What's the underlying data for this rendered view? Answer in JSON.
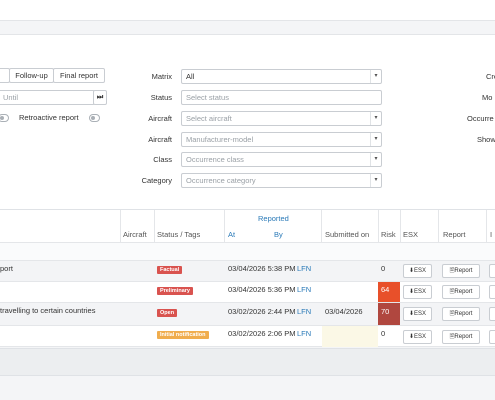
{
  "tabs": [
    "Follow-up",
    "Final report"
  ],
  "until_placeholder": "Until",
  "last_icon": "⏭",
  "retroactive_label": "Retroactive report",
  "filters": {
    "matrix_label": "Matrix",
    "matrix_value": "All",
    "status_label": "Status",
    "status_placeholder": "Select status",
    "aircraft_label": "Aircraft",
    "aircraft_placeholder": "Select aircraft",
    "aircraft2_label": "Aircraft",
    "aircraft2_placeholder": "Manufacturer-model",
    "class_label": "Class",
    "class_placeholder": "Occurrence class",
    "category_label": "Category",
    "category_placeholder": "Occurrence category"
  },
  "right_labels": [
    "Cre",
    "Mo",
    "Occurre",
    "Show"
  ],
  "table": {
    "headers": {
      "aircraft": "Aircraft",
      "status_tags": "Status / Tags",
      "reported": "Reported",
      "at": "At",
      "by": "By",
      "submitted_on": "Submitted on",
      "risk": "Risk",
      "esx": "ESX",
      "report": "Report",
      "last": "I"
    },
    "rows": [
      {
        "title": "port",
        "tag": "Factual",
        "tag_color": "#d9534f",
        "at": "03/04/2026 5:38 PM",
        "by": "LFN",
        "submitted": "",
        "risk": "0",
        "risk_color": "",
        "esx": "ESX",
        "report": "Report"
      },
      {
        "title": "",
        "tag": "Preliminary",
        "tag_color": "#d9534f",
        "at": "03/04/2026 5:36 PM",
        "by": "LFN",
        "submitted": "",
        "risk": "64",
        "risk_color": "#e8502a",
        "esx": "ESX",
        "report": "Report"
      },
      {
        "title": "travelling to certain countries",
        "tag": "Open",
        "tag_color": "#d9534f",
        "at": "03/02/2026 2:44 PM",
        "by": "LFN",
        "submitted": "03/04/2026",
        "risk": "70",
        "risk_color": "#b0473f",
        "esx": "ESX",
        "report": "Report"
      },
      {
        "title": "",
        "tag": "Initial notification",
        "tag_color": "#f0ad4e",
        "at": "03/02/2026 2:06 PM",
        "by": "LFN",
        "submitted": "",
        "risk": "0",
        "risk_color": "",
        "esx": "ESX",
        "report": "Report"
      }
    ]
  }
}
